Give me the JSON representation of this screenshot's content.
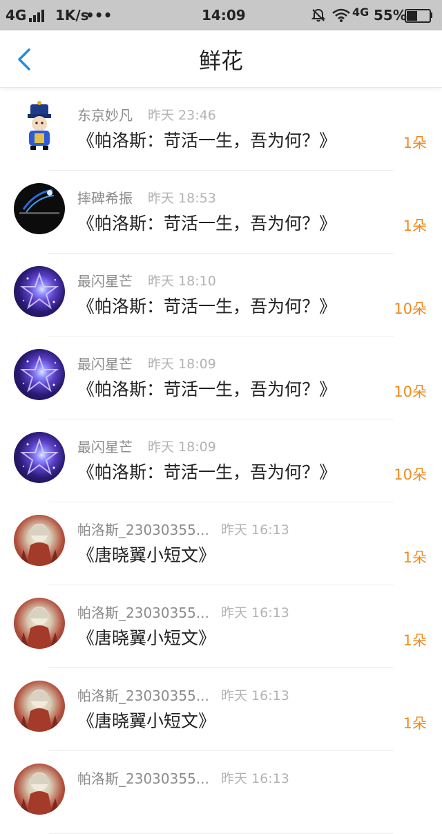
{
  "status_bar": {
    "network": "4G",
    "speed": "1K/s",
    "dots": "•••",
    "time": "14:09",
    "network2": "4G",
    "battery": "55%",
    "battery_level": 0.55
  },
  "header": {
    "title": "鲜花"
  },
  "items": [
    {
      "name": "东京妙凡",
      "time": "昨天 23:46",
      "book": "《帕洛斯：苛活一生，吾为何？》",
      "count": "1朵",
      "avatar": "doll"
    },
    {
      "name": "摔碑希振",
      "time": "昨天 18:53",
      "book": "《帕洛斯：苛活一生，吾为何？》",
      "count": "1朵",
      "avatar": "dark"
    },
    {
      "name": "最闪星芒",
      "time": "昨天 18:10",
      "book": "《帕洛斯：苛活一生，吾为何？》",
      "count": "10朵",
      "avatar": "galaxy"
    },
    {
      "name": "最闪星芒",
      "time": "昨天 18:09",
      "book": "《帕洛斯：苛活一生，吾为何？》",
      "count": "10朵",
      "avatar": "galaxy"
    },
    {
      "name": "最闪星芒",
      "time": "昨天 18:09",
      "book": "《帕洛斯：苛活一生，吾为何？》",
      "count": "10朵",
      "avatar": "galaxy"
    },
    {
      "name": "帕洛斯_23030355...",
      "time": "昨天 16:13",
      "book": "《唐晓翼小短文》",
      "count": "1朵",
      "avatar": "anime"
    },
    {
      "name": "帕洛斯_23030355...",
      "time": "昨天 16:13",
      "book": "《唐晓翼小短文》",
      "count": "1朵",
      "avatar": "anime"
    },
    {
      "name": "帕洛斯_23030355...",
      "time": "昨天 16:13",
      "book": "《唐晓翼小短文》",
      "count": "1朵",
      "avatar": "anime"
    },
    {
      "name": "帕洛斯_23030355...",
      "time": "昨天 16:13",
      "book": "",
      "count": "",
      "avatar": "anime"
    }
  ],
  "colors": {
    "accent": "#1e8ee8",
    "count": "#f08a1d"
  }
}
